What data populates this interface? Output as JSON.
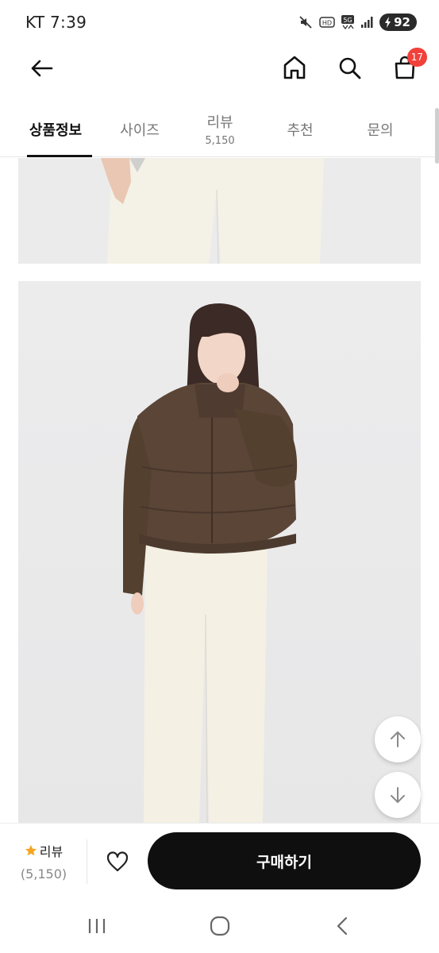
{
  "status_bar": {
    "carrier_time": "KT 7:39",
    "network": "5G",
    "battery_level": "92"
  },
  "header": {
    "cart_badge": "17"
  },
  "tabs": [
    {
      "label": "상품정보",
      "active": true
    },
    {
      "label": "사이즈",
      "active": false
    },
    {
      "label": "리뷰",
      "count": "5,150",
      "active": false
    },
    {
      "label": "추천",
      "active": false
    },
    {
      "label": "문의",
      "active": false
    }
  ],
  "bottom_bar": {
    "review_label": "리뷰",
    "review_count": "(5,150)",
    "buy_label": "구매하기"
  },
  "colors": {
    "accent_badge": "#f1413b",
    "buy_button": "#0f0f0f",
    "star": "#f5a623",
    "jacket": "#5b4537",
    "pants": "#f3efe4"
  }
}
